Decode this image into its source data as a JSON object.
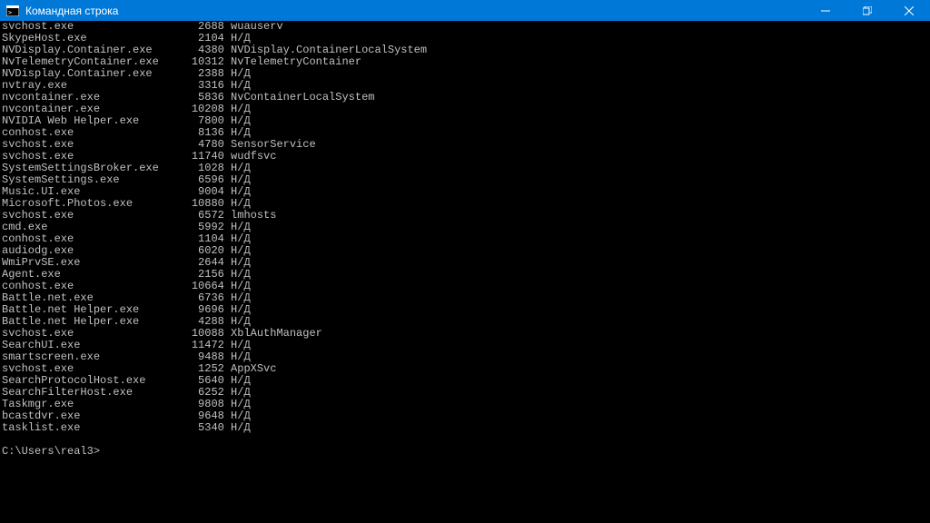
{
  "titlebar": {
    "title": "Командная строка"
  },
  "rows": [
    {
      "name": "svchost.exe",
      "pid": "2688",
      "svc": "wuauserv"
    },
    {
      "name": "SkypeHost.exe",
      "pid": "2104",
      "svc": "Н/Д"
    },
    {
      "name": "NVDisplay.Container.exe",
      "pid": "4380",
      "svc": "NVDisplay.ContainerLocalSystem"
    },
    {
      "name": "NvTelemetryContainer.exe",
      "pid": "10312",
      "svc": "NvTelemetryContainer"
    },
    {
      "name": "NVDisplay.Container.exe",
      "pid": "2388",
      "svc": "Н/Д"
    },
    {
      "name": "nvtray.exe",
      "pid": "3316",
      "svc": "Н/Д"
    },
    {
      "name": "nvcontainer.exe",
      "pid": "5836",
      "svc": "NvContainerLocalSystem"
    },
    {
      "name": "nvcontainer.exe",
      "pid": "10208",
      "svc": "Н/Д"
    },
    {
      "name": "NVIDIA Web Helper.exe",
      "pid": "7800",
      "svc": "Н/Д"
    },
    {
      "name": "conhost.exe",
      "pid": "8136",
      "svc": "Н/Д"
    },
    {
      "name": "svchost.exe",
      "pid": "4780",
      "svc": "SensorService"
    },
    {
      "name": "svchost.exe",
      "pid": "11740",
      "svc": "wudfsvc"
    },
    {
      "name": "SystemSettingsBroker.exe",
      "pid": "1028",
      "svc": "Н/Д"
    },
    {
      "name": "SystemSettings.exe",
      "pid": "6596",
      "svc": "Н/Д"
    },
    {
      "name": "Music.UI.exe",
      "pid": "9004",
      "svc": "Н/Д"
    },
    {
      "name": "Microsoft.Photos.exe",
      "pid": "10880",
      "svc": "Н/Д"
    },
    {
      "name": "svchost.exe",
      "pid": "6572",
      "svc": "lmhosts"
    },
    {
      "name": "cmd.exe",
      "pid": "5992",
      "svc": "Н/Д"
    },
    {
      "name": "conhost.exe",
      "pid": "1104",
      "svc": "Н/Д"
    },
    {
      "name": "audiodg.exe",
      "pid": "6020",
      "svc": "Н/Д"
    },
    {
      "name": "WmiPrvSE.exe",
      "pid": "2644",
      "svc": "Н/Д"
    },
    {
      "name": "Agent.exe",
      "pid": "2156",
      "svc": "Н/Д"
    },
    {
      "name": "conhost.exe",
      "pid": "10664",
      "svc": "Н/Д"
    },
    {
      "name": "Battle.net.exe",
      "pid": "6736",
      "svc": "Н/Д"
    },
    {
      "name": "Battle.net Helper.exe",
      "pid": "9696",
      "svc": "Н/Д"
    },
    {
      "name": "Battle.net Helper.exe",
      "pid": "4288",
      "svc": "Н/Д"
    },
    {
      "name": "svchost.exe",
      "pid": "10088",
      "svc": "XblAuthManager"
    },
    {
      "name": "SearchUI.exe",
      "pid": "11472",
      "svc": "Н/Д"
    },
    {
      "name": "smartscreen.exe",
      "pid": "9488",
      "svc": "Н/Д"
    },
    {
      "name": "svchost.exe",
      "pid": "1252",
      "svc": "AppXSvc"
    },
    {
      "name": "SearchProtocolHost.exe",
      "pid": "5640",
      "svc": "Н/Д"
    },
    {
      "name": "SearchFilterHost.exe",
      "pid": "6252",
      "svc": "Н/Д"
    },
    {
      "name": "Taskmgr.exe",
      "pid": "9808",
      "svc": "Н/Д"
    },
    {
      "name": "bcastdvr.exe",
      "pid": "9648",
      "svc": "Н/Д"
    },
    {
      "name": "tasklist.exe",
      "pid": "5340",
      "svc": "Н/Д"
    }
  ],
  "prompt": "C:\\Users\\real3>",
  "columns": {
    "nameWidth": 26,
    "pidWidth": 8
  }
}
